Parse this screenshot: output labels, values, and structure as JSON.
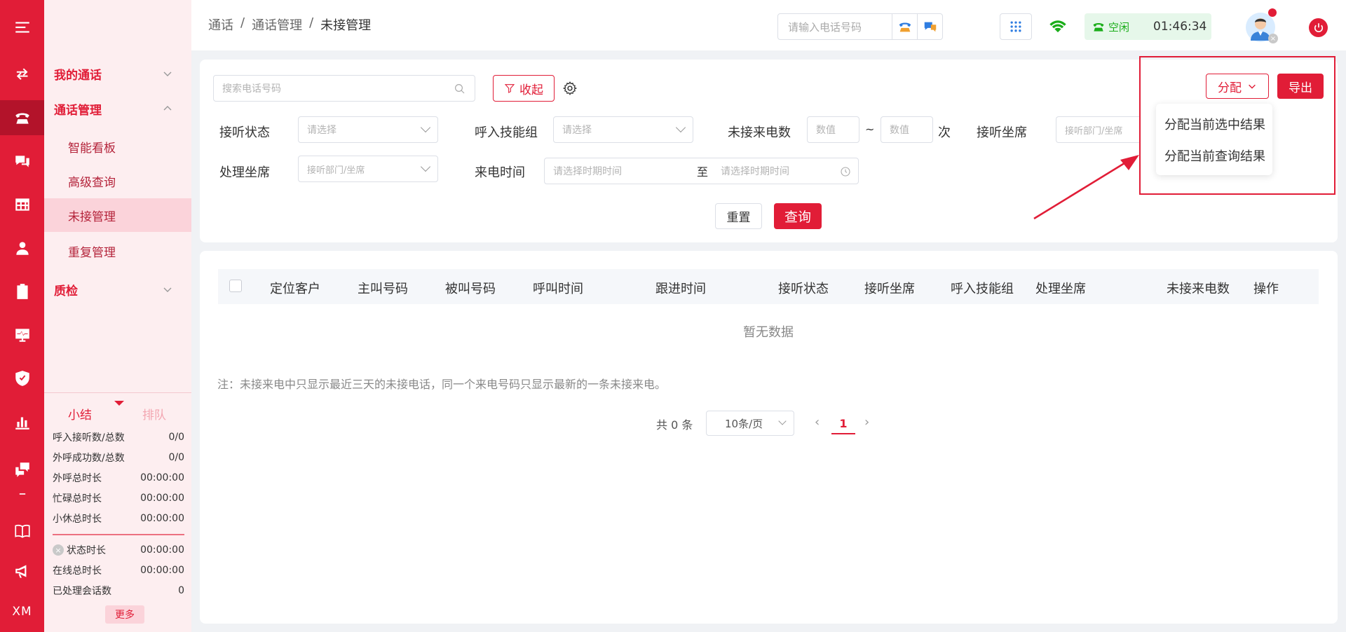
{
  "colors": {
    "brand": "#e11d37",
    "menu_bg": "#fdeef0",
    "menu_active": "#fbd3da",
    "status_bg": "#e6f7ea",
    "status_text": "#1aad19"
  },
  "rail": {
    "icons": [
      "menu-icon",
      "transfer-icon",
      "phone-icon",
      "chat-icon",
      "table-icon",
      "user-icon",
      "clipboard-icon",
      "monitor-icon",
      "shield-icon",
      "bar-chart-icon",
      "comments-icon",
      "book-icon",
      "megaphone-icon"
    ],
    "bottom_text": "XM"
  },
  "menu": {
    "groups": [
      {
        "label": "我的通话"
      },
      {
        "label": "通话管理"
      },
      {
        "label": "质检"
      }
    ],
    "items": [
      {
        "label": "智能看板"
      },
      {
        "label": "高级查询"
      },
      {
        "label": "未接管理"
      },
      {
        "label": "重复管理"
      }
    ],
    "tabs": {
      "summary": "小结",
      "queue": "排队"
    },
    "stats": [
      {
        "label": "呼入接听数/总数",
        "value": "0/0"
      },
      {
        "label": "外呼成功数/总数",
        "value": "0/0"
      },
      {
        "label": "外呼总时长",
        "value": "00:00:00"
      },
      {
        "label": "忙碌总时长",
        "value": "00:00:00"
      },
      {
        "label": "小休总时长",
        "value": "00:00:00"
      },
      {
        "label": "状态时长",
        "value": "00:00:00"
      },
      {
        "label": "在线总时长",
        "value": "00:00:00"
      },
      {
        "label": "已处理会话数",
        "value": "0"
      }
    ],
    "more": "更多"
  },
  "header": {
    "breadcrumb": [
      "通话",
      "/",
      "通话管理",
      "/",
      "未接管理"
    ],
    "phone_placeholder": "请输入电话号码",
    "status": "空闲",
    "timer": "01:46:34"
  },
  "filters": {
    "search_placeholder": "搜索电话号码",
    "collapse": "收起",
    "answer_status": {
      "label": "接听状态",
      "placeholder": "请选择"
    },
    "skill_group": {
      "label": "呼入技能组",
      "placeholder": "请选择"
    },
    "missed_count": {
      "label": "未接来电数",
      "min_placeholder": "数值",
      "tilde": "~",
      "max_placeholder": "数值",
      "unit": "次"
    },
    "answer_agent": {
      "label": "接听坐席",
      "placeholder": "接听部门/坐席"
    },
    "handle_agent": {
      "label": "处理坐席",
      "placeholder": "接听部门/坐席"
    },
    "call_time": {
      "label": "来电时间",
      "start_placeholder": "请选择时期时间",
      "to": "至",
      "end_placeholder": "请选择时期时间"
    },
    "reset": "重置",
    "query": "查询",
    "assign": "分配",
    "export": "导出",
    "assign_menu": [
      "分配当前选中结果",
      "分配当前查询结果"
    ]
  },
  "table": {
    "columns": [
      "定位客户",
      "主叫号码",
      "被叫号码",
      "呼叫时间",
      "跟进时间",
      "接听状态",
      "接听坐席",
      "呼入技能组",
      "处理坐席",
      "未接来电数",
      "操作"
    ],
    "empty": "暂无数据",
    "note": "注：未接来电中只显示最近三天的未接电话，同一个来电号码只显示最新的一条未接来电。"
  },
  "pager": {
    "total": "共 0 条",
    "page_size": "10条/页",
    "current": "1"
  }
}
